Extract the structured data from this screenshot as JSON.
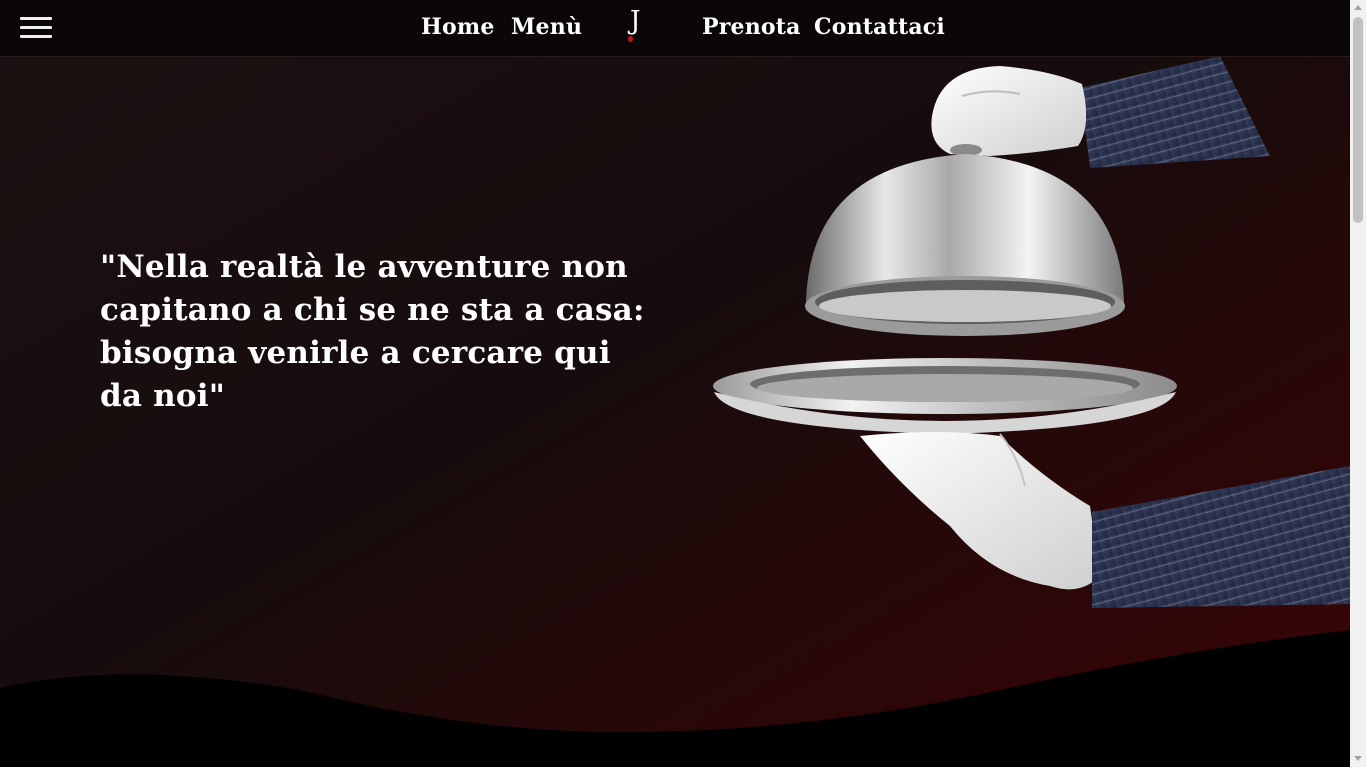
{
  "nav": {
    "menu_icon": "hamburger-menu-icon",
    "links": {
      "home": "Home",
      "menu": "Menù",
      "book": "Prenota",
      "contact": "Contattaci"
    },
    "logo_letter": "J"
  },
  "hero": {
    "quote": "\"Nella realtà le avventure non capitano a chi se ne sta a casa: bisogna venirle a cercare qui da noi\"",
    "image": "waiter-serving-cloche-image"
  },
  "colors": {
    "header_bg": "#0b0707",
    "hero_dark": "#1d1112",
    "hero_red": "#3a0506",
    "text": "#ffffff",
    "logo_accent": "#c11a1a"
  }
}
